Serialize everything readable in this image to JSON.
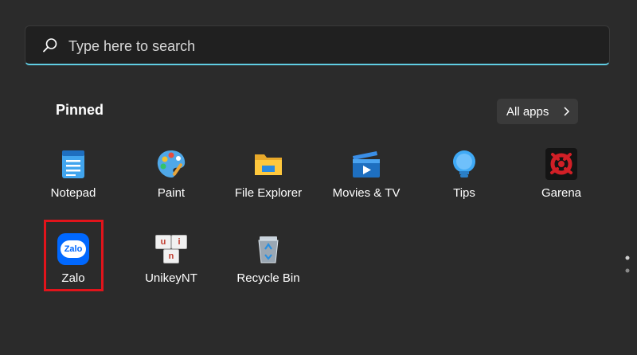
{
  "search": {
    "placeholder": "Type here to search"
  },
  "pinned": {
    "title": "Pinned",
    "all_apps_label": "All apps"
  },
  "apps": [
    {
      "label": "Notepad",
      "icon": "notepad-icon"
    },
    {
      "label": "Paint",
      "icon": "paint-palette-icon"
    },
    {
      "label": "File Explorer",
      "icon": "folder-icon"
    },
    {
      "label": "Movies & TV",
      "icon": "movies-tv-icon"
    },
    {
      "label": "Tips",
      "icon": "lightbulb-icon"
    },
    {
      "label": "Garena",
      "icon": "garena-icon"
    },
    {
      "label": "Zalo",
      "icon": "zalo-icon",
      "icon_text": "Zalo",
      "highlighted": true
    },
    {
      "label": "UnikeyNT",
      "icon": "unikey-icon",
      "keys": [
        "u",
        "i",
        "n"
      ]
    },
    {
      "label": "Recycle Bin",
      "icon": "recycle-bin-icon"
    }
  ],
  "colors": {
    "background": "#2b2b2b",
    "search_accent": "#60cde3",
    "highlight": "#e1141b"
  }
}
